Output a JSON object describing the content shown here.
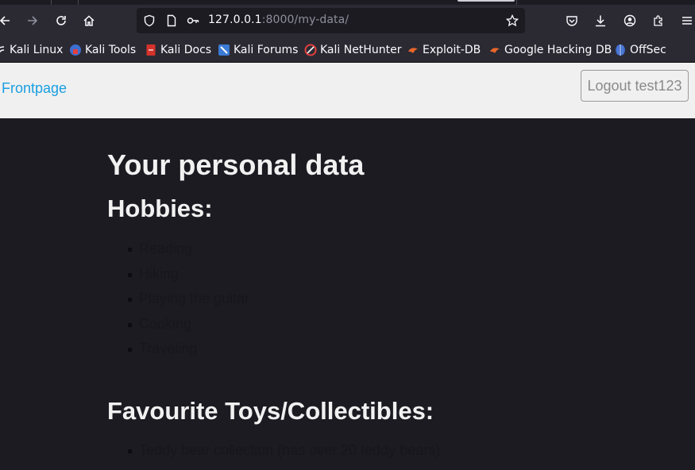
{
  "browser": {
    "url_host": "127.0.0.1",
    "url_port_path": ":8000/my-data/",
    "bookmarks": [
      {
        "label": "Kali Linux",
        "icon": "kali-dragon-icon"
      },
      {
        "label": "Kali Tools",
        "icon": "kali-tools-icon"
      },
      {
        "label": "Kali Docs",
        "icon": "kali-docs-icon"
      },
      {
        "label": "Kali Forums",
        "icon": "kali-forums-icon"
      },
      {
        "label": "Kali NetHunter",
        "icon": "kali-nethunter-icon"
      },
      {
        "label": "Exploit-DB",
        "icon": "exploit-db-icon"
      },
      {
        "label": "Google Hacking DB",
        "icon": "ghdb-icon"
      },
      {
        "label": "OffSec",
        "icon": "offsec-icon"
      }
    ]
  },
  "header": {
    "frontpage_label": "Frontpage",
    "logout_label": "Logout test123"
  },
  "main": {
    "title": "Your personal data",
    "sections": [
      {
        "heading": "Hobbies:",
        "items": [
          "Reading",
          "Hiking",
          "Playing the guitar",
          "Cooking",
          "Traveling"
        ]
      },
      {
        "heading": "Favourite Toys/Collectibles:",
        "items": [
          "Teddy bear collection (has over 20 teddy bears)"
        ]
      }
    ]
  },
  "colors": {
    "page_background": "#1c1b22",
    "header_background": "#f0f0f0",
    "link": "#1a9fe0",
    "chrome": "#2b2a33"
  }
}
